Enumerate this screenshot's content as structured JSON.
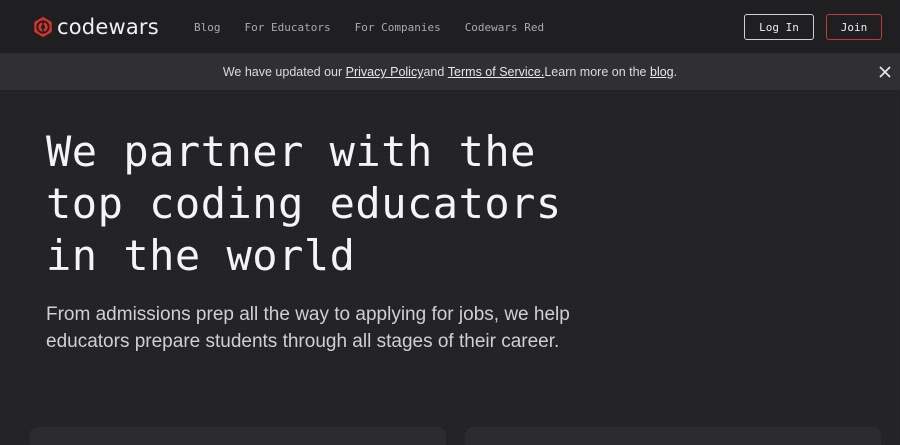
{
  "nav": {
    "brand": "codewars",
    "links": [
      {
        "label": "Blog"
      },
      {
        "label": "For Educators"
      },
      {
        "label": "For Companies"
      },
      {
        "label": "Codewars Red"
      }
    ],
    "login_label": "Log In",
    "join_label": "Join"
  },
  "notice": {
    "prefix": "We have updated our ",
    "privacy_link": "Privacy Policy",
    "and": " and ",
    "terms_link": "Terms of Service.",
    "middle": " Learn more on the ",
    "blog_link": "blog",
    "suffix": "."
  },
  "hero": {
    "title_lines": [
      "We partner with the",
      "top coding educators",
      "in the world"
    ],
    "subtitle_lines": [
      "From admissions prep all the way to applying for jobs, we help",
      "educators prepare students through all stages of their career."
    ]
  },
  "colors": {
    "brand_red": "#d6332b",
    "background": "#232326",
    "notice_bg": "#303034"
  },
  "icons": {
    "logo": "codewars-logo-icon",
    "close": "close-icon"
  }
}
